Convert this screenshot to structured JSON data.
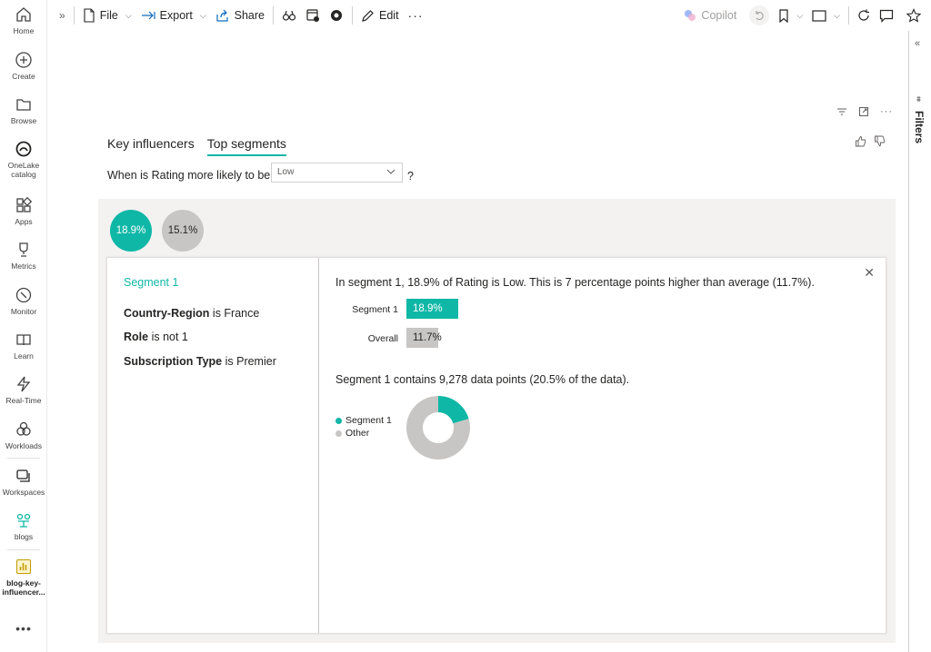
{
  "nav": {
    "items": [
      {
        "label": "Home"
      },
      {
        "label": "Create"
      },
      {
        "label": "Browse"
      },
      {
        "label_line1": "OneLake",
        "label_line2": "catalog"
      },
      {
        "label": "Apps"
      },
      {
        "label": "Metrics"
      },
      {
        "label": "Monitor"
      },
      {
        "label": "Learn"
      },
      {
        "label": "Real-Time"
      },
      {
        "label": "Workloads"
      },
      {
        "label": "Workspaces"
      },
      {
        "label": "blogs"
      },
      {
        "label_line1": "blog-key-",
        "label_line2": "influencer..."
      }
    ],
    "more": "•••"
  },
  "toolbar": {
    "file": "File",
    "export": "Export",
    "share": "Share",
    "edit": "Edit",
    "more": "···",
    "copilot": "Copilot"
  },
  "filters": {
    "label": "Filters"
  },
  "visual": {
    "tabs": [
      "Key influencers",
      "Top segments"
    ],
    "question_prefix": "When is Rating more likely to be",
    "dropdown_value": "Low",
    "question_suffix": "?",
    "bubbles": [
      "18.9%",
      "15.1%"
    ]
  },
  "segment": {
    "title": "Segment 1",
    "conditions": [
      {
        "field": "Country-Region",
        "op": "is France"
      },
      {
        "field": "Role",
        "op": "is not 1"
      },
      {
        "field": "Subscription Type",
        "op": "is Premier"
      }
    ],
    "summary": "In segment 1, 18.9% of Rating is Low. This is 7 percentage points higher than average (11.7%).",
    "bar_segment_label": "Segment 1",
    "bar_overall_label": "Overall",
    "contains": "Segment 1 contains 9,278 data points (20.5% of the data).",
    "legend_segment": "Segment 1",
    "legend_other": "Other"
  },
  "colors": {
    "accent": "#0fb7a6",
    "gray": "#c8c6c4"
  },
  "chart_data": [
    {
      "type": "bar",
      "categories": [
        "Segment 1",
        "Overall"
      ],
      "values": [
        18.9,
        11.7
      ],
      "value_labels": [
        "18.9%",
        "11.7%"
      ],
      "xlim": [
        0,
        20
      ]
    },
    {
      "type": "pie",
      "categories": [
        "Segment 1",
        "Other"
      ],
      "values": [
        20.5,
        79.5
      ]
    }
  ]
}
